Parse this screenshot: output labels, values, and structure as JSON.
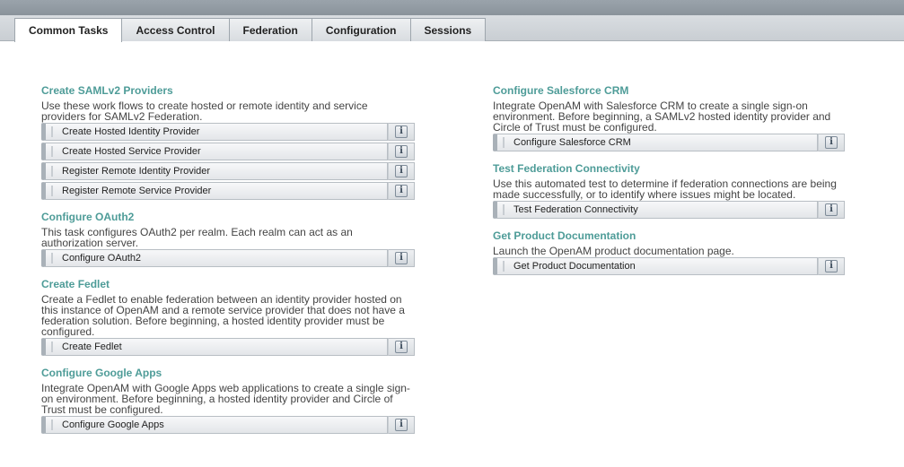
{
  "tabs": [
    {
      "label": "Common Tasks",
      "active": true
    },
    {
      "label": "Access Control",
      "active": false
    },
    {
      "label": "Federation",
      "active": false
    },
    {
      "label": "Configuration",
      "active": false
    },
    {
      "label": "Sessions",
      "active": false
    }
  ],
  "info_glyph": "i",
  "left": {
    "saml": {
      "title": "Create SAMLv2 Providers",
      "desc": "Use these work flows to create hosted or remote identity and service providers for SAMLv2 Federation.",
      "tasks": [
        "Create Hosted Identity Provider",
        "Create Hosted Service Provider",
        "Register Remote Identity Provider",
        "Register Remote Service Provider"
      ]
    },
    "oauth": {
      "title": "Configure OAuth2",
      "desc": "This task configures OAuth2 per realm. Each realm can act as an authorization server.",
      "tasks": [
        "Configure OAuth2"
      ]
    },
    "fedlet": {
      "title": "Create Fedlet",
      "desc": "Create a Fedlet to enable federation between an identity provider hosted on this instance of OpenAM and a remote service provider that does not have a federation solution. Before beginning, a hosted identity provider must be configured.",
      "tasks": [
        "Create Fedlet"
      ]
    },
    "google": {
      "title": "Configure Google Apps",
      "desc": "Integrate OpenAM with Google Apps web applications to create a single sign-on environment. Before beginning, a hosted identity provider and Circle of Trust must be configured.",
      "tasks": [
        "Configure Google Apps"
      ]
    }
  },
  "right": {
    "salesforce": {
      "title": "Configure Salesforce CRM",
      "desc": "Integrate OpenAM with Salesforce CRM to create a single sign-on environment. Before beginning, a SAMLv2 hosted identity provider and Circle of Trust must be configured.",
      "tasks": [
        "Configure Salesforce CRM"
      ]
    },
    "test": {
      "title": "Test Federation Connectivity",
      "desc": "Use this automated test to determine if federation connections are being made successfully, or to identify where issues might be located.",
      "tasks": [
        "Test Federation Connectivity"
      ]
    },
    "docs": {
      "title": "Get Product Documentation",
      "desc": "Launch the OpenAM product documentation page.",
      "tasks": [
        "Get Product Documentation"
      ]
    }
  }
}
